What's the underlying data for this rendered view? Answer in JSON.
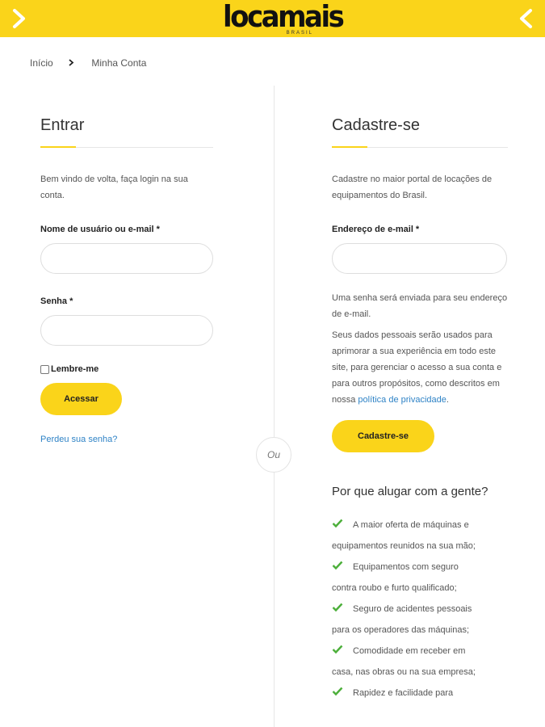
{
  "header": {
    "logo_text": "locamais",
    "logo_sub": "BRASIL",
    "accent_color": "#fad41a"
  },
  "breadcrumb": {
    "home": "Início",
    "current": "Minha Conta"
  },
  "login": {
    "title": "Entrar",
    "intro": "Bem vindo de volta, faça login na sua conta.",
    "username_label": "Nome de usuário ou e-mail *",
    "password_label": "Senha *",
    "remember_label": "Lembre-me",
    "submit_label": "Acessar",
    "lost_password_link": "Perdeu sua senha?"
  },
  "divider": {
    "or_text": "Ou"
  },
  "register": {
    "title": "Cadastre-se",
    "intro": "Cadastre no maior portal de locações de equipamentos do Brasil.",
    "email_label": "Endereço de e-mail *",
    "password_note": "Uma senha será enviada para seu endereço de e-mail.",
    "privacy_text": "Seus dados pessoais serão usados para aprimorar a sua experiência em todo este site, para gerenciar o acesso a sua conta e para outros propósitos, como descritos em nossa",
    "privacy_link": "política de privacidade",
    "privacy_suffix": ".",
    "submit_label": "Cadastre-se"
  },
  "why": {
    "title": "Por que alugar com a gente?",
    "items": [
      {
        "first": "A maior oferta de máquinas e",
        "rest": "equipamentos reunidos na sua mão;"
      },
      {
        "first": "Equipamentos com seguro",
        "rest": "contra roubo e furto qualificado;"
      },
      {
        "first": "Seguro de acidentes pessoais",
        "rest": "para os operadores das máquinas;"
      },
      {
        "first": "Comodidade em receber em",
        "rest": "casa, nas obras ou na sua empresa;"
      },
      {
        "first": "Rapidez e facilidade para",
        "rest": ""
      }
    ],
    "icon": "check-icon",
    "check_color": "#4caf3a"
  }
}
